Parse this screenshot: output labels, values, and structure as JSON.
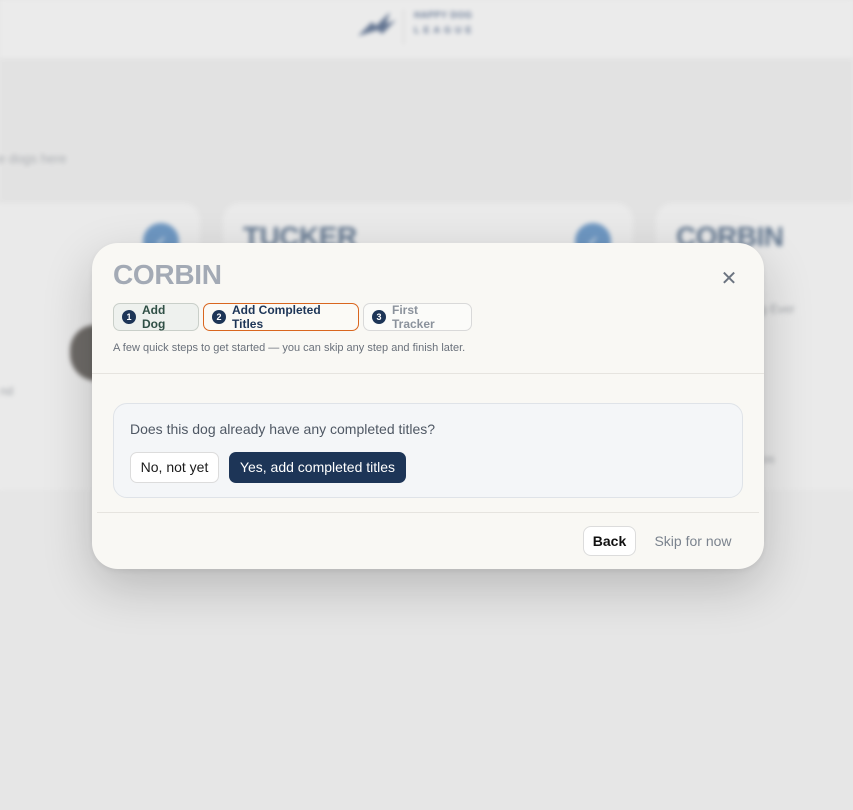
{
  "background": {
    "logo_line1": "HAPPY DOG",
    "logo_line2": "LEAGUE",
    "subtext": "e dogs here",
    "cards": [
      {
        "name": "",
        "badge_icon": "check-badge"
      },
      {
        "name": "TUCKER",
        "badge_icon": "check-badge"
      },
      {
        "name": "CORBIN",
        "badge_icon": ""
      }
    ],
    "fragments": [
      "nd",
      "g Ever",
      "os"
    ]
  },
  "modal": {
    "title": "CORBIN",
    "close_icon": "close-icon",
    "steps": [
      {
        "number": "1",
        "label": "Add Dog",
        "state": "done"
      },
      {
        "number": "2",
        "label": "Add Completed Titles",
        "state": "active"
      },
      {
        "number": "3",
        "label": "First Tracker",
        "state": "todo"
      }
    ],
    "hint": "A few quick steps to get started — you can skip any step and finish later.",
    "question": "Does this dog already have any completed titles?",
    "no_label": "No, not yet",
    "yes_label": "Yes, add completed titles",
    "back_label": "Back",
    "skip_label": "Skip for now"
  },
  "colors": {
    "primary": "#1d3557",
    "active_step_border": "#d9661f",
    "title_muted": "#a3aab5"
  }
}
